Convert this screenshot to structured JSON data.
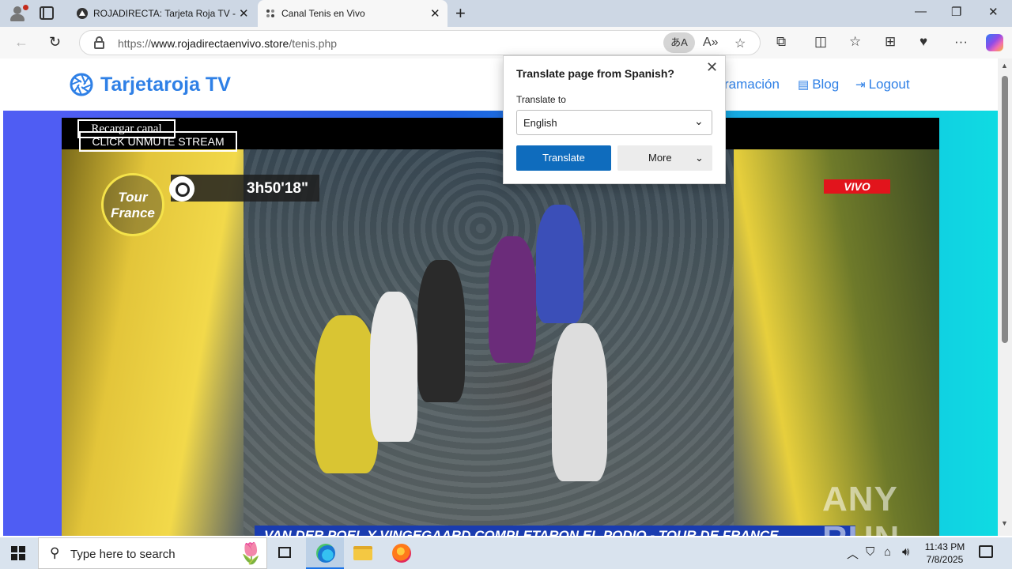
{
  "browser": {
    "tabs": [
      {
        "title": "ROJADIRECTA: Tarjeta Roja TV - Pi",
        "active": false
      },
      {
        "title": "Canal Tenis en Vivo",
        "active": true
      }
    ],
    "url_scheme": "https://",
    "url_host": "www.rojadirectaenvivo.store",
    "url_path": "/tenis.php"
  },
  "site": {
    "brand": "Tarjetaroja TV",
    "nav": [
      {
        "label": "ramación",
        "icon": ""
      },
      {
        "label": "Blog",
        "icon": "blog-icon"
      },
      {
        "label": "Logout",
        "icon": "logout-icon"
      }
    ],
    "accent_color": "#2f80e6"
  },
  "player": {
    "reload_label": "Recargar canal",
    "unmute_label": "CLICK UNMUTE STREAM",
    "timer": "3h50'18\"",
    "live_badge": "VIVO",
    "ticker": "VAN DER POEL Y VINGEGAARD COMPLETARON EL PODIO - TOUR DE FRANCE",
    "watermark": "ANY RUN"
  },
  "translate_popup": {
    "title": "Translate page from Spanish?",
    "label": "Translate to",
    "selected_language": "English",
    "translate_button": "Translate",
    "more_button": "More"
  },
  "taskbar": {
    "search_placeholder": "Type here to search",
    "time": "11:43 PM",
    "date": "7/8/2025"
  }
}
